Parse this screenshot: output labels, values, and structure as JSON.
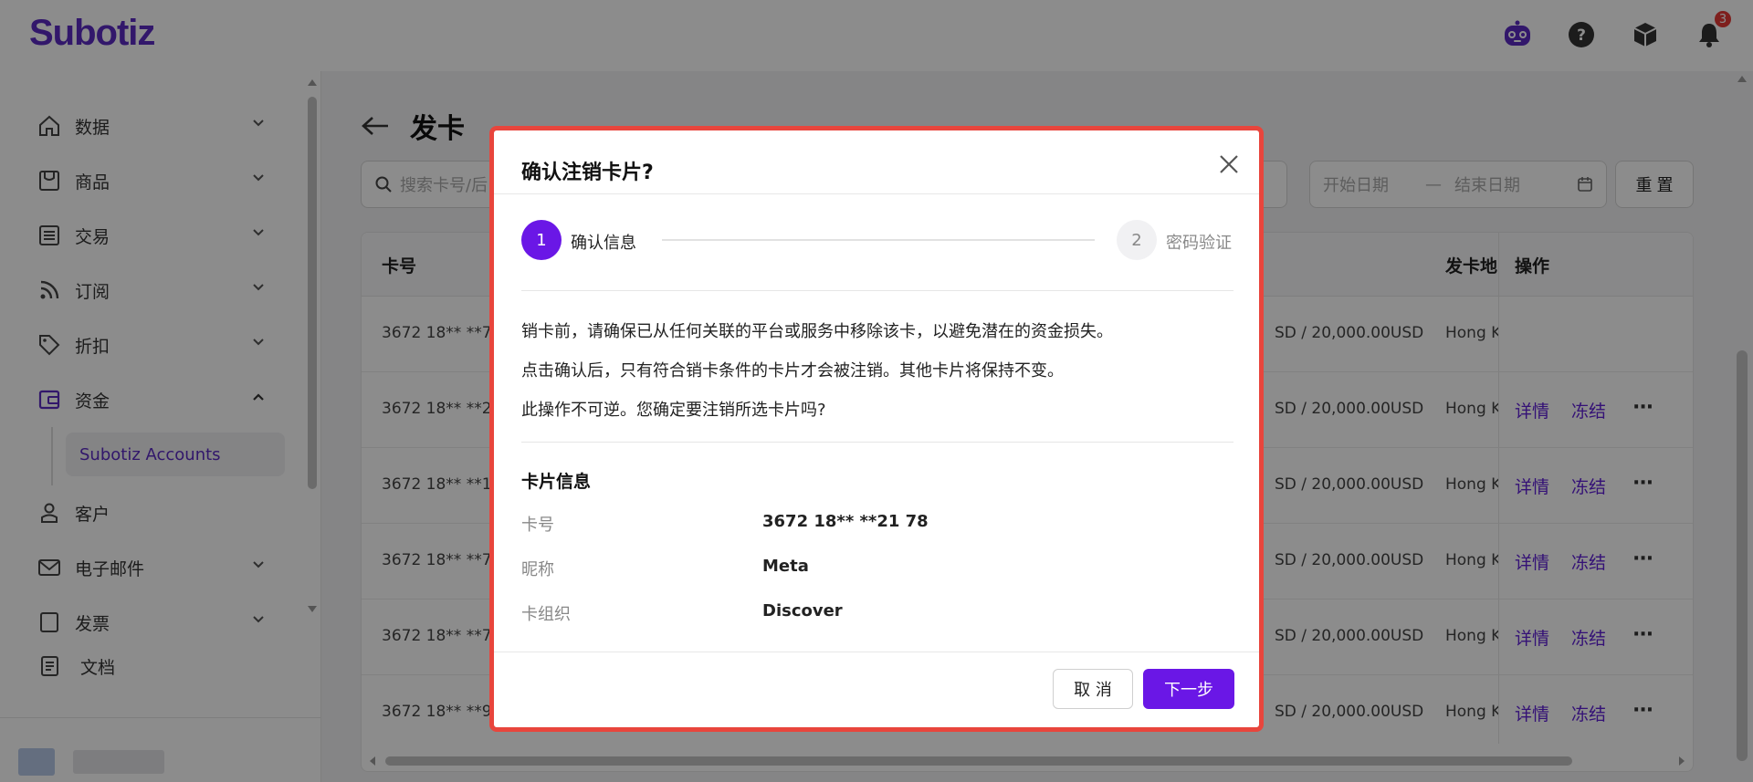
{
  "app": {
    "logo": "Subotiz",
    "notification_count": "3"
  },
  "sidebar": {
    "items": [
      {
        "label": "数据",
        "icon": "home-icon"
      },
      {
        "label": "商品",
        "icon": "store-icon"
      },
      {
        "label": "交易",
        "icon": "list-icon"
      },
      {
        "label": "订阅",
        "icon": "rss-icon"
      },
      {
        "label": "折扣",
        "icon": "tag-icon"
      },
      {
        "label": "资金",
        "icon": "wallet-icon"
      },
      {
        "label": "客户",
        "icon": "user-icon"
      },
      {
        "label": "电子邮件",
        "icon": "mail-icon"
      },
      {
        "label": "发票",
        "icon": "invoice-icon"
      }
    ],
    "sub_item": "Subotiz Accounts",
    "docs_label": "文档"
  },
  "page": {
    "title": "发卡",
    "search_placeholder": "搜索卡号/后",
    "start_date_placeholder": "开始日期",
    "date_separator": "—",
    "end_date_placeholder": "结束日期",
    "reset_label": "重 置"
  },
  "table": {
    "headers": {
      "card_no": "卡号",
      "issuer_region": "发卡地",
      "actions": "操作"
    },
    "rows": [
      {
        "card": "3672 18** **7",
        "limit": "SD / 20,000.00USD",
        "region": "Hong K",
        "actions": false
      },
      {
        "card": "3672 18** **2",
        "limit": "SD / 20,000.00USD",
        "region": "Hong K",
        "actions": true
      },
      {
        "card": "3672 18** **1",
        "limit": "SD / 20,000.00USD",
        "region": "Hong K",
        "actions": true
      },
      {
        "card": "3672 18** **7",
        "limit": "SD / 20,000.00USD",
        "region": "Hong K",
        "actions": true
      },
      {
        "card": "3672 18** **7",
        "limit": "SD / 20,000.00USD",
        "region": "Hong K",
        "actions": true
      },
      {
        "card": "3672 18** **9",
        "limit": "SD / 20,000.00USD",
        "region": "Hong K",
        "actions": true
      }
    ],
    "action_labels": {
      "detail": "详情",
      "freeze": "冻结",
      "more": "···"
    }
  },
  "modal": {
    "title": "确认注销卡片?",
    "steps": [
      {
        "number": "1",
        "label": "确认信息",
        "active": true
      },
      {
        "number": "2",
        "label": "密码验证",
        "active": false
      }
    ],
    "messages": [
      "销卡前，请确保已从任何关联的平台或服务中移除该卡，以避免潜在的资金损失。",
      "点击确认后，只有符合销卡条件的卡片才会被注销。其他卡片将保持不变。",
      "此操作不可逆。您确定要注销所选卡片吗?"
    ],
    "card_info_title": "卡片信息",
    "card_info": [
      {
        "key": "卡号",
        "value": "3672 18** **21 78"
      },
      {
        "key": "昵称",
        "value": "Meta"
      },
      {
        "key": "卡组织",
        "value": "Discover"
      }
    ],
    "cancel_label": "取 消",
    "next_label": "下一步"
  },
  "colors": {
    "brand": "#5b2bc4",
    "primary": "#6a17e6",
    "badge": "#e53935",
    "highlight_border": "#e8453c"
  }
}
